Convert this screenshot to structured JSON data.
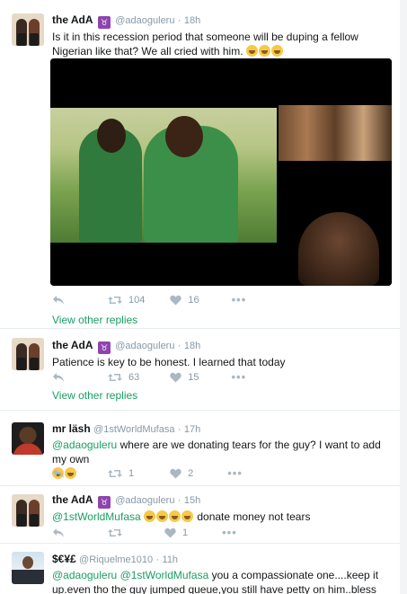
{
  "tweets": [
    {
      "name": "the AdA",
      "badge": "♉",
      "handle": "@adaoguleru",
      "dot": "·",
      "time": "18h",
      "text": "Is it in this recession period that someone will be duping a fellow Nigerian like that? We all cried with him.",
      "emoji_count": 3,
      "retweets": "104",
      "likes": "16",
      "view_replies": "View other replies"
    },
    {
      "name": "the AdA",
      "badge": "♉",
      "handle": "@adaoguleru",
      "dot": "·",
      "time": "18h",
      "text": "Patience is key to be honest. I learned that today",
      "retweets": "63",
      "likes": "15",
      "view_replies": "View other replies"
    },
    {
      "name": "mr läsh",
      "handle": "@1stWorldMufasa",
      "dot": "·",
      "time": "17h",
      "mention": "@adaoguleru",
      "text": "where are we donating tears for the guy? I want to add my own",
      "emoji_count": 2,
      "retweets": "1",
      "likes": "2"
    },
    {
      "name": "the AdA",
      "badge": "♉",
      "handle": "@adaoguleru",
      "dot": "·",
      "time": "15h",
      "mention": "@1stWorldMufasa",
      "text": "donate money not tears",
      "emoji_count": 4,
      "retweets": "",
      "likes": "1"
    },
    {
      "name": "$€¥£",
      "handle": "@Riquelme1010",
      "dot": "·",
      "time": "11h",
      "mention1": "@adaoguleru",
      "mention2": "@1stWorldMufasa",
      "text": "you a compassionate one....keep it up.even tho the guy jumped queue,you still have petty on him..bless up"
    }
  ],
  "icons": {
    "reply": "reply-icon",
    "retweet": "retweet-icon",
    "like": "heart-icon",
    "more": "more-icon"
  },
  "colors": {
    "accent": "#1a9e63",
    "rail": "#9ad3b2",
    "muted": "#8899a6"
  }
}
